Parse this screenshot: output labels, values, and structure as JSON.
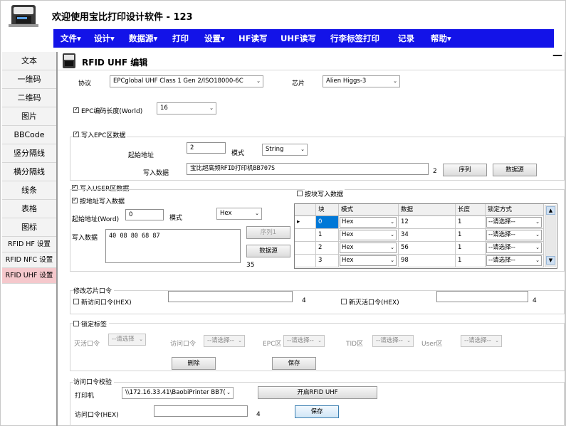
{
  "app": {
    "title": "欢迎使用宝比打印设计软件 - 123"
  },
  "menu": [
    "文件▾",
    "设计▾",
    "数据源▾",
    "打印",
    "设置▾",
    "HF读写",
    "UHF读写",
    "行李标签打印",
    "记录",
    "帮助▾"
  ],
  "sidebar": [
    "文本",
    "一维码",
    "二维码",
    "图片",
    "BBCode",
    "竖分隔线",
    "横分隔线",
    "线条",
    "表格",
    "图标",
    "RFID HF 设置",
    "RFID NFC 设置",
    "RFID UHF 设置"
  ],
  "panel": {
    "title": "RFID  UHF 编辑",
    "minimize": "—"
  },
  "protocol": {
    "label": "协议",
    "value": "EPCglobal UHF Class 1 Gen 2/ISO18000-6C",
    "chip_label": "芯片",
    "chip_value": "Alien Higgs-3"
  },
  "epc_len": {
    "label": "EPC编码长度(World)",
    "value": "16"
  },
  "epc": {
    "label": "写入EPC区数据",
    "start_label": "起始地址",
    "start_value": "2",
    "mode_label": "模式",
    "mode_value": "String",
    "data_label": "写入数据",
    "data_value": "宝比超高频RFID打印机BB707S",
    "count": "2",
    "seq_btn": "序列",
    "ds_btn": "数据源"
  },
  "user": {
    "label": "写入USER区数据",
    "by_addr_label": "按地址写入数据",
    "by_block_label": "按块写入数据",
    "start_label": "起始地址(Word)",
    "start_value": "0",
    "mode_label": "模式",
    "mode_value": "Hex",
    "data_label": "写入数据",
    "data_value": "40 08 80 68 87",
    "seq_btn": "序列1",
    "ds_btn": "数据源",
    "count": "35"
  },
  "grid": {
    "headers": [
      "块",
      "模式",
      "数据",
      "长度",
      "锁定方式"
    ],
    "rows": [
      {
        "block": "0",
        "mode": "Hex",
        "data": "12",
        "len": "1",
        "lock": "--请选择--"
      },
      {
        "block": "1",
        "mode": "Hex",
        "data": "34",
        "len": "1",
        "lock": "--请选择--"
      },
      {
        "block": "2",
        "mode": "Hex",
        "data": "56",
        "len": "1",
        "lock": "--请选择--"
      },
      {
        "block": "3",
        "mode": "Hex",
        "data": "98",
        "len": "1",
        "lock": "--请选择--"
      }
    ]
  },
  "pwd": {
    "group_label": "修改芯片口令",
    "new_access_label": "新访问口令(HEX)",
    "access_count": "4",
    "new_kill_label": "新灭活口令(HEX)",
    "kill_count": "4"
  },
  "lock": {
    "label": "锁定标签",
    "kill_label": "灭活口令",
    "kill_value": "--请选择",
    "access_label": "访问口令",
    "access_value": "--请选择--",
    "epc_label": "EPC区",
    "epc_value": "--请选择--",
    "tid_label": "TID区",
    "tid_value": "--请选择--",
    "user_label": "User区",
    "user_value": "--请选择--",
    "delete_btn": "删除",
    "save_btn": "保存"
  },
  "verify": {
    "group_label": "访问口令校验",
    "printer_label": "打印机",
    "printer_value": "\\\\172.16.33.41\\BaobiPrinter BB7(",
    "open_btn": "开启RFID  UHF",
    "access_label": "访问口令(HEX)",
    "count": "4",
    "save_btn": "保存"
  }
}
